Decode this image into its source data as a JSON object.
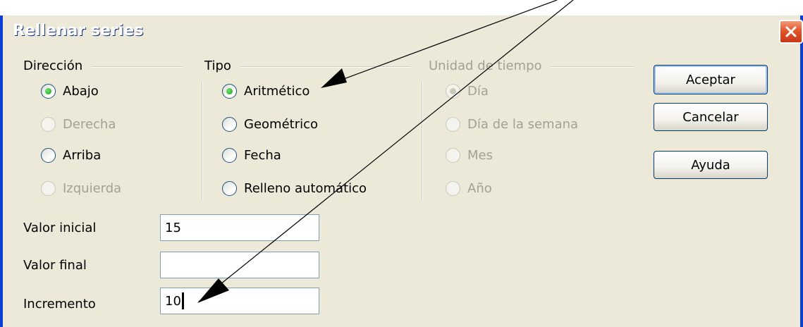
{
  "dialog": {
    "title": "Rellenar series",
    "close_label": "✕"
  },
  "direction": {
    "label": "Dirección",
    "options": [
      {
        "label": "Abajo",
        "selected": true,
        "enabled": true
      },
      {
        "label": "Derecha",
        "selected": false,
        "enabled": false
      },
      {
        "label": "Arriba",
        "selected": false,
        "enabled": true
      },
      {
        "label": "Izquierda",
        "selected": false,
        "enabled": false
      }
    ]
  },
  "type": {
    "label": "Tipo",
    "options": [
      {
        "label": "Aritmético",
        "selected": true,
        "enabled": true
      },
      {
        "label": "Geométrico",
        "selected": false,
        "enabled": true
      },
      {
        "label": "Fecha",
        "selected": false,
        "enabled": true
      },
      {
        "label": "Relleno automático",
        "selected": false,
        "enabled": true
      }
    ]
  },
  "time_unit": {
    "label": "Unidad de tiempo",
    "options": [
      {
        "label": "Día",
        "selected": true,
        "enabled": false
      },
      {
        "label": "Día de la semana",
        "selected": false,
        "enabled": false
      },
      {
        "label": "Mes",
        "selected": false,
        "enabled": false
      },
      {
        "label": "Año",
        "selected": false,
        "enabled": false
      }
    ]
  },
  "fields": {
    "start_label": "Valor inicial",
    "start_value": "15",
    "end_label": "Valor final",
    "end_value": "",
    "increment_label": "Incremento",
    "increment_value": "10"
  },
  "buttons": {
    "ok": "Aceptar",
    "cancel": "Cancelar",
    "help": "Ayuda"
  },
  "colors": {
    "title_bar": "#0954e0",
    "dialog_bg": "#ece9d8",
    "close_button": "#e2552a",
    "radio_dot": "#21a121"
  }
}
